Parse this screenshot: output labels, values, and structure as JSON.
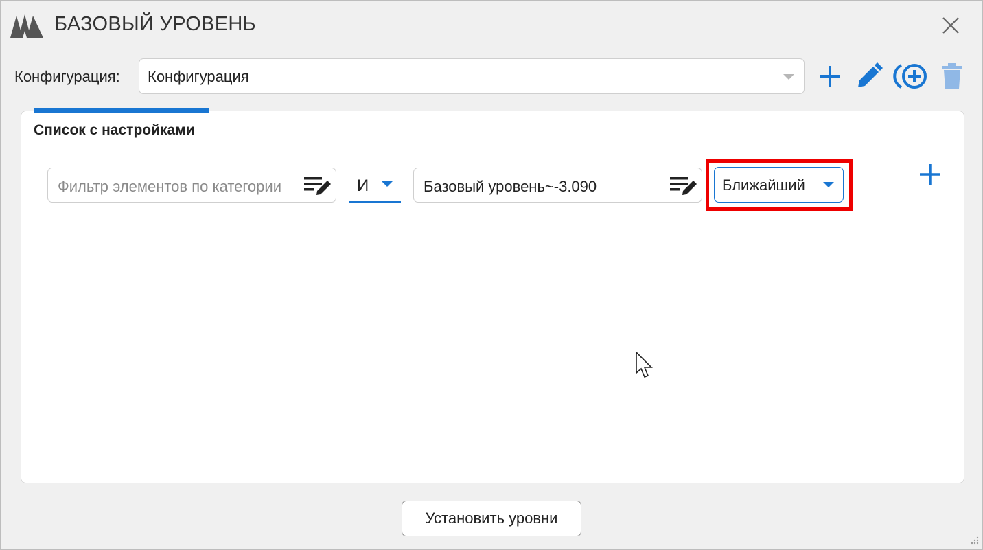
{
  "window": {
    "title": "БАЗОВЫЙ УРОВЕНЬ",
    "accent_color": "#1976d2",
    "highlight_color": "#ee0000"
  },
  "config": {
    "label": "Конфигурация:",
    "selected": "Конфигурация"
  },
  "toolbar": {
    "icons": [
      "add-icon",
      "pencil-icon",
      "circle-plus-icon",
      "trash-icon"
    ]
  },
  "tab": {
    "title": "Список с настройками"
  },
  "filter_row": {
    "category_filter_placeholder": "Фильтр элементов по категории",
    "logic_operator": "И",
    "level_value": "Базовый уровень~-3.090",
    "mode": "Ближайший"
  },
  "footer": {
    "apply_label": "Установить уровни"
  }
}
